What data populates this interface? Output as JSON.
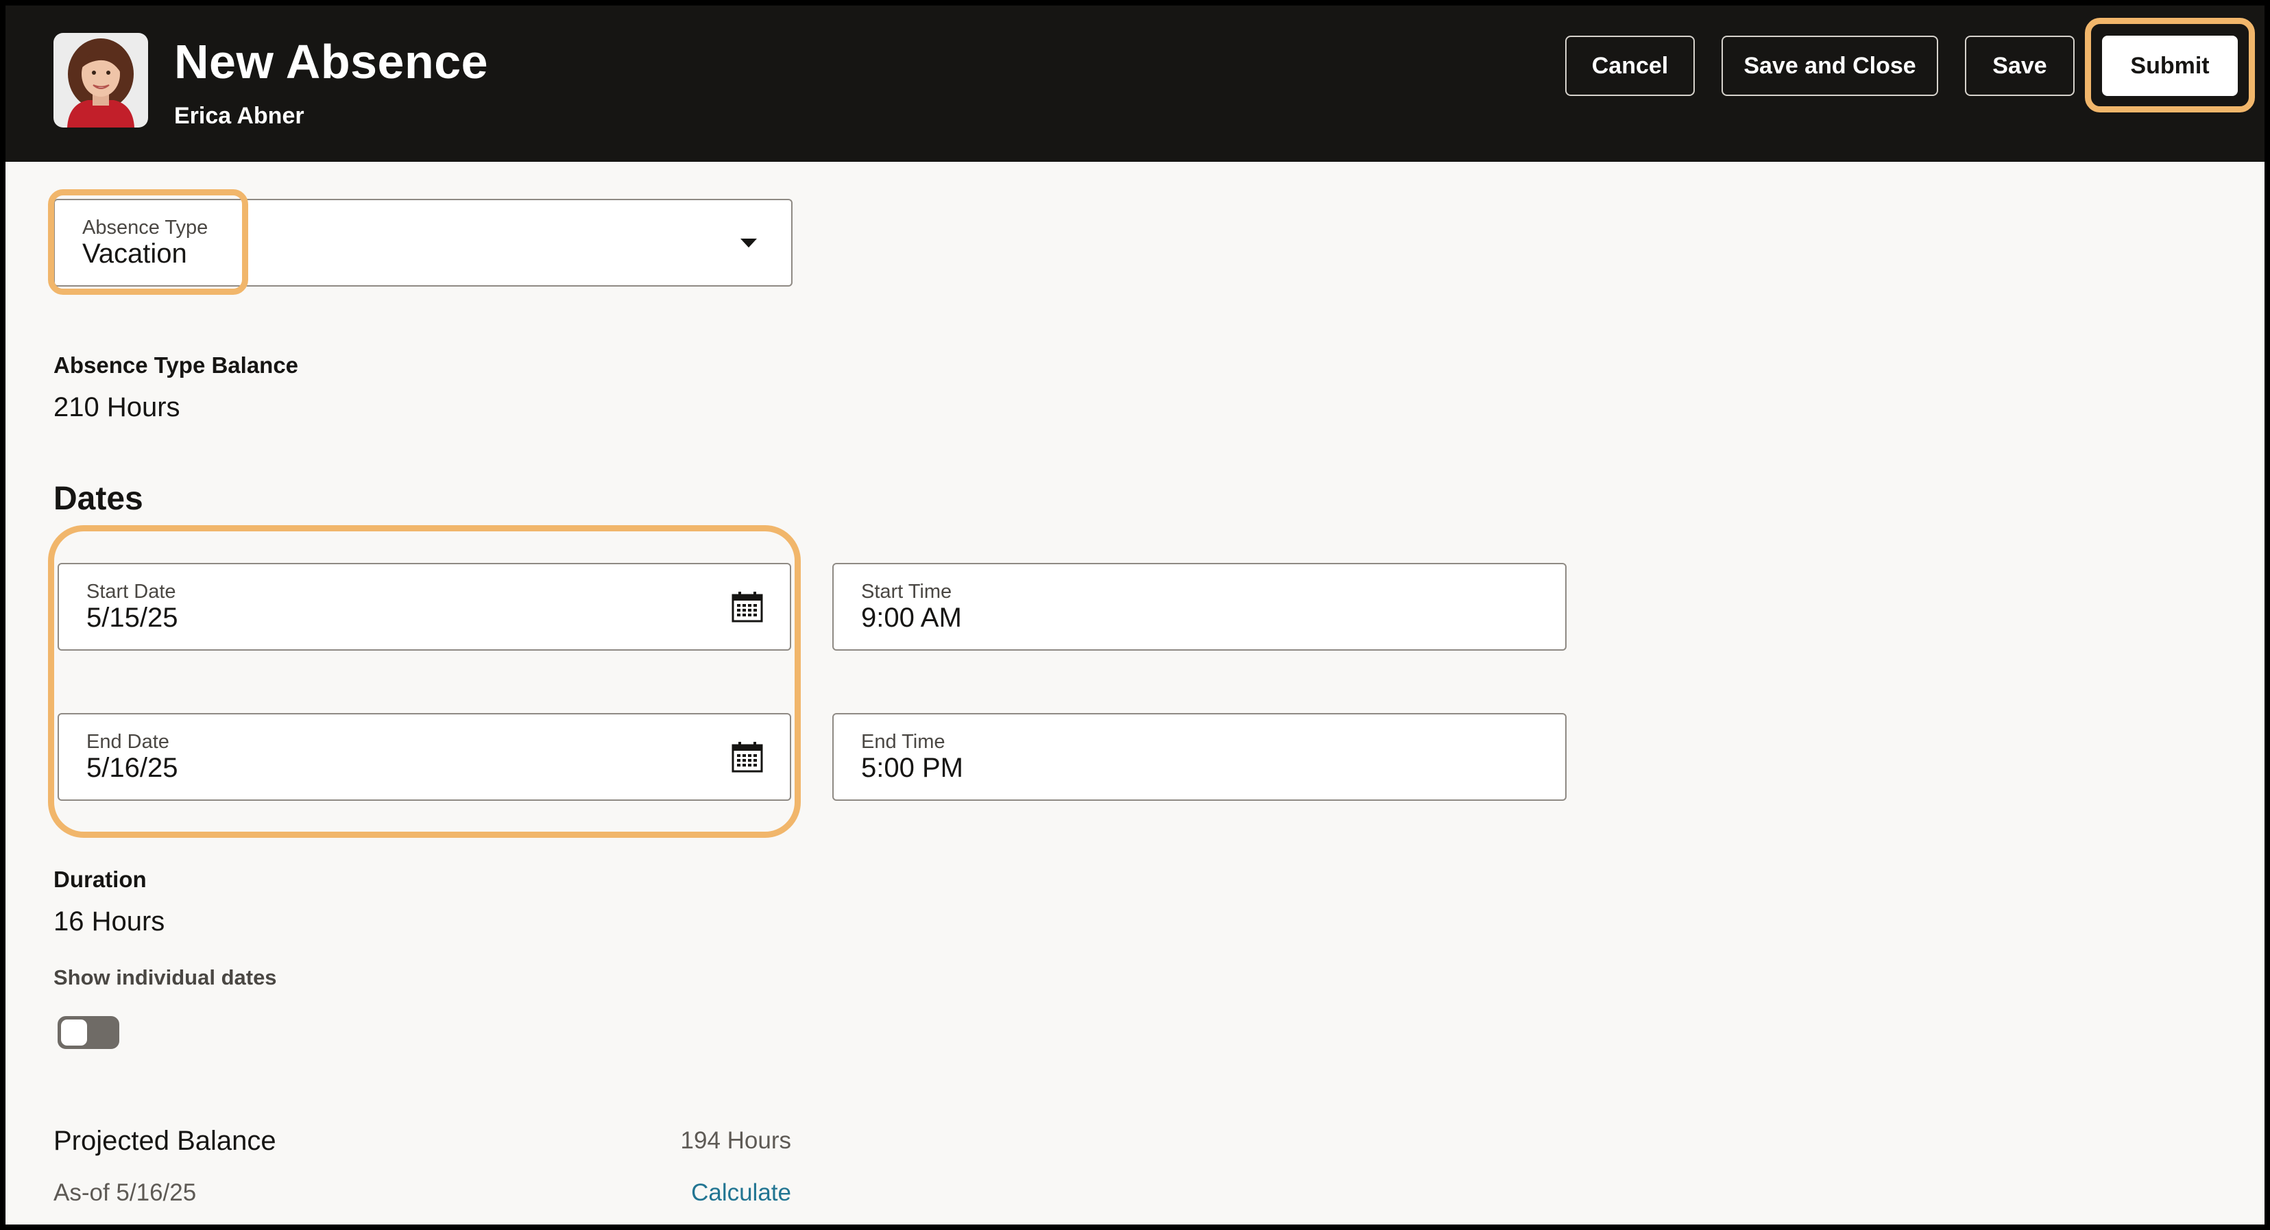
{
  "header": {
    "title": "New Absence",
    "employee_name": "Erica Abner",
    "buttons": {
      "cancel": "Cancel",
      "save_and_close": "Save and Close",
      "save": "Save",
      "submit": "Submit"
    }
  },
  "absence_type": {
    "label": "Absence Type",
    "value": "Vacation"
  },
  "balance": {
    "label": "Absence Type Balance",
    "value": "210 Hours"
  },
  "dates": {
    "section_title": "Dates",
    "start_date": {
      "label": "Start Date",
      "value": "5/15/25"
    },
    "start_time": {
      "label": "Start Time",
      "value": "9:00 AM"
    },
    "end_date": {
      "label": "End Date",
      "value": "5/16/25"
    },
    "end_time": {
      "label": "End Time",
      "value": "5:00 PM"
    }
  },
  "duration": {
    "label": "Duration",
    "value": "16 Hours",
    "toggle_label": "Show individual dates",
    "toggle_on": false
  },
  "projected": {
    "label": "Projected Balance",
    "value": "194 Hours",
    "as_of": "As-of 5/16/25",
    "calculate_link": "Calculate"
  },
  "colors": {
    "header_bg": "#161513",
    "highlight": "#f1b66b",
    "link": "#227592"
  }
}
